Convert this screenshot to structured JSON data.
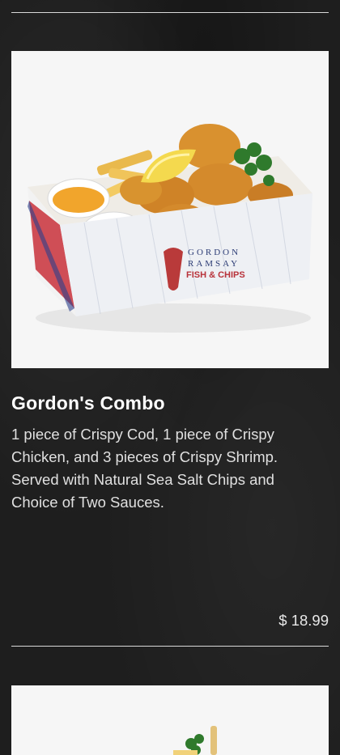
{
  "items": [
    {
      "name": "Gordon's Combo",
      "description": "1 piece of Crispy Cod, 1 piece of Crispy Chicken, and 3 pieces of Crispy Shrimp. Served with Natural Sea Salt Chips and Choice of Two Sauces.",
      "price": "$ 18.99",
      "box_brand": {
        "line1": "GORDON",
        "line2": "RAMSAY",
        "line3": "FISH & CHIPS"
      }
    }
  ],
  "colors": {
    "background": "#1e1e1e",
    "divider": "#d9d9d9",
    "text": "#ffffff"
  }
}
